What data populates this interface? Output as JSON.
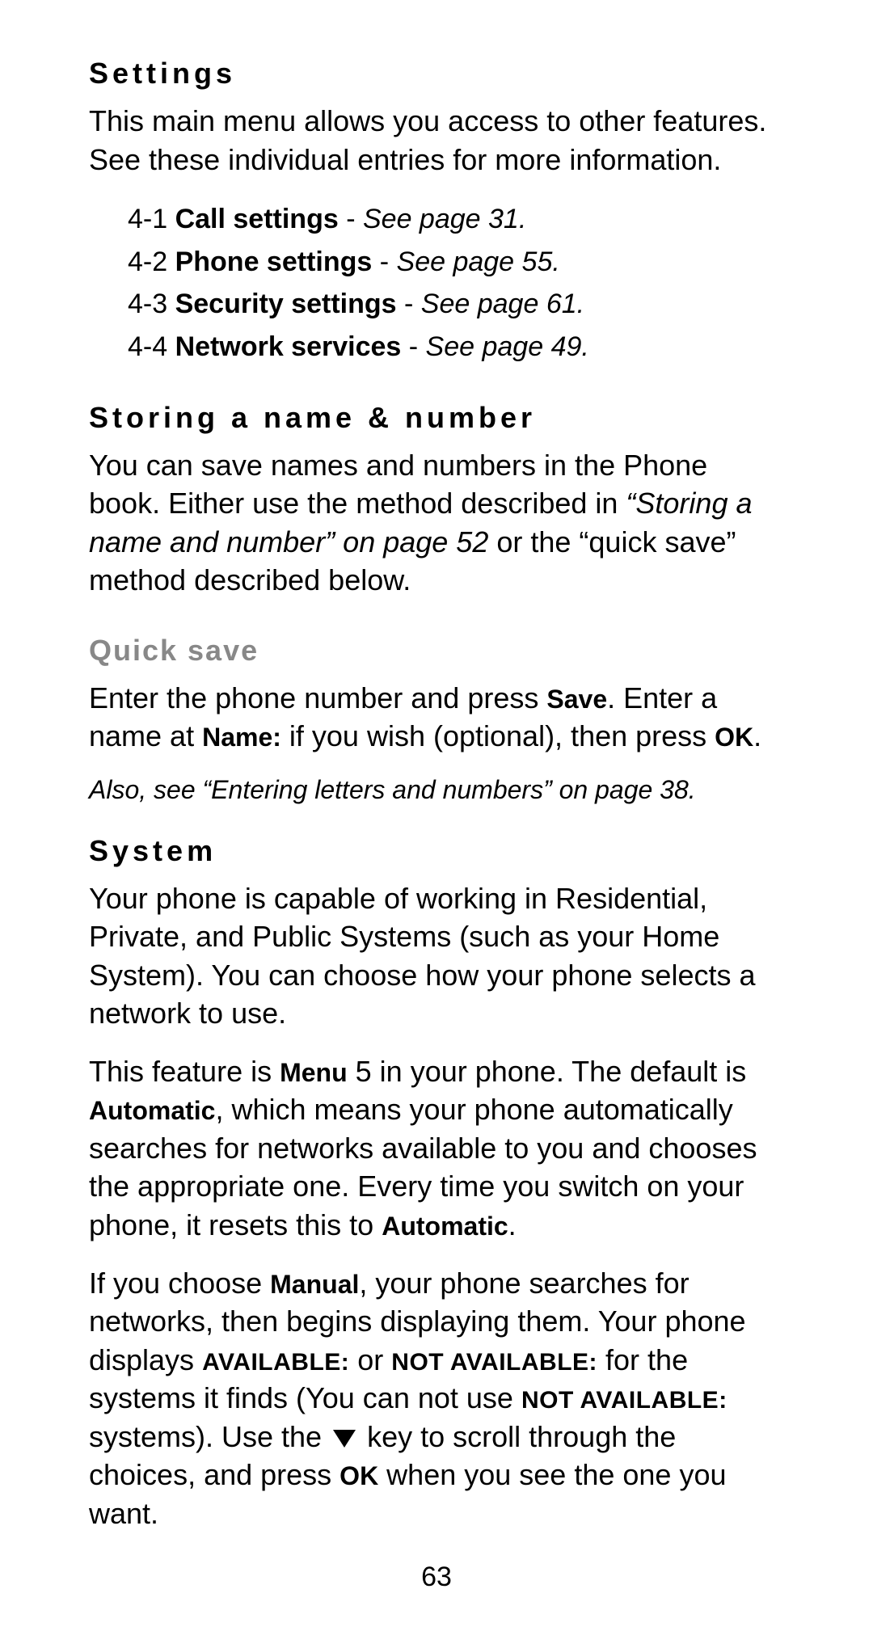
{
  "settings": {
    "heading": "Settings",
    "intro": "This main menu allows you access to other features. See these individual entries for more information.",
    "refs": [
      {
        "prefix": "4-1",
        "bold": "Call settings",
        "sep": " - ",
        "italic": "See page 31."
      },
      {
        "prefix": "4-2",
        "bold": "Phone settings",
        "sep": " - ",
        "italic": "See page 55."
      },
      {
        "prefix": "4-3",
        "bold": "Security settings",
        "sep": " - ",
        "italic": "See page 61."
      },
      {
        "prefix": "4-4",
        "bold": "Network services",
        "sep": " - ",
        "italic": "See page 49."
      }
    ]
  },
  "storing": {
    "heading": "Storing a name & number",
    "para_a": "You can save names and numbers in the Phone book. Either use the method described in ",
    "para_ref_italic": "“Storing a name and number” on page 52",
    "para_b": " or the “quick save” method described below."
  },
  "quicksave": {
    "heading": "Quick save",
    "p_a": "Enter the phone number and press ",
    "save_b": "Save",
    "p_b": ". Enter a name at ",
    "name_b": "Name:",
    "p_c": " if you wish (optional), then press ",
    "ok_b": "OK",
    "p_d": ".",
    "note": "Also, see “Entering letters and numbers” on page 38."
  },
  "system": {
    "heading": "System",
    "p1": "Your phone is capable of working in Residential, Private, and Public Systems (such as your Home System). You can choose how your phone selects a network to use.",
    "p2_a": "This feature is ",
    "menu_b": "Menu",
    "p2_b": " 5 in your phone. The default is ",
    "auto_b": "Automatic",
    "p2_c": ", which means your phone automatically searches for networks available to you and chooses the appropriate one. Every time you switch on your phone, it resets this to ",
    "auto_b2": "Automatic",
    "p2_d": ".",
    "p3_a": "If you choose ",
    "manual_b": "Manual",
    "p3_b": ", your phone searches for networks, then begins displaying them. Your phone displays ",
    "avail_b": "AVAILABLE:",
    "p3_c": " or ",
    "navail_b": "NOT AVAILABLE:",
    "p3_d": " for the systems it finds (You can not use ",
    "navail_b2": "NOT AVAILABLE:",
    "p3_e": " systems). Use the ",
    "p3_f": " key to scroll through the choices, and press ",
    "ok_b": "OK",
    "p3_g": " when you see the one you want."
  },
  "page_number": "63"
}
